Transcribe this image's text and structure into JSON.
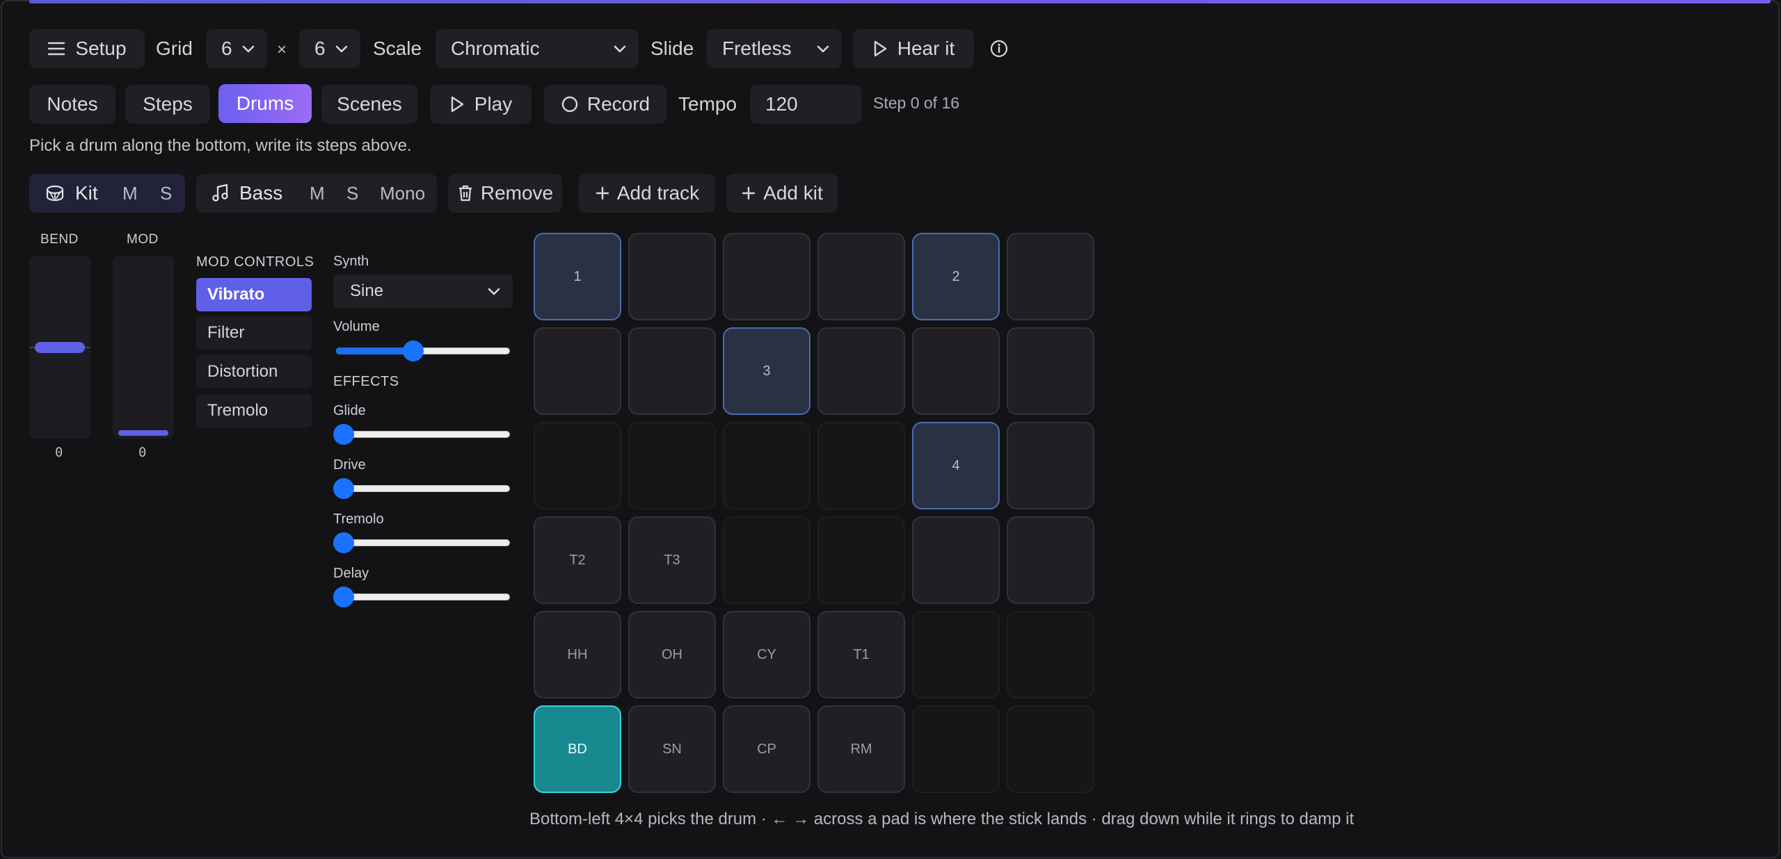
{
  "toolbar": {
    "setup_label": "Setup",
    "grid_label": "Grid",
    "grid_cols": "6",
    "times": "×",
    "grid_rows": "6",
    "scale_label": "Scale",
    "scale_value": "Chromatic",
    "slide_label": "Slide",
    "slide_value": "Fretless",
    "hear_label": "Hear it"
  },
  "tabs": {
    "notes": "Notes",
    "steps": "Steps",
    "drums": "Drums",
    "scenes": "Scenes",
    "active": "Drums"
  },
  "transport": {
    "play_label": "Play",
    "record_label": "Record",
    "tempo_label": "Tempo",
    "tempo_value": "120",
    "step_status": "Step 0 of 16"
  },
  "hint": "Pick a drum along the bottom, write its steps above.",
  "tracks": {
    "kit": {
      "name": "Kit",
      "mute": "M",
      "solo": "S"
    },
    "bass": {
      "name": "Bass",
      "mute": "M",
      "solo": "S",
      "mono": "Mono"
    },
    "remove_label": "Remove",
    "add_track_label": "Add track",
    "add_kit_label": "Add kit"
  },
  "bend": {
    "label": "BEND",
    "value": "0",
    "level": 0.5
  },
  "mod": {
    "label": "MOD",
    "value": "0",
    "level": 0
  },
  "mod_controls": {
    "title": "MOD CONTROLS",
    "items": [
      "Vibrato",
      "Filter",
      "Distortion",
      "Tremolo"
    ],
    "selected": "Vibrato"
  },
  "synth": {
    "label": "Synth",
    "value": "Sine",
    "volume_label": "Volume",
    "volume": 0.44,
    "effects_title": "EFFECTS",
    "glide_label": "Glide",
    "glide": 0,
    "drive_label": "Drive",
    "drive": 0,
    "tremolo_label": "Tremolo",
    "tremolo": 0,
    "delay_label": "Delay",
    "delay": 0
  },
  "pads": [
    [
      {
        "t": "step",
        "label": "1"
      },
      {
        "t": "normal",
        "label": ""
      },
      {
        "t": "normal",
        "label": ""
      },
      {
        "t": "normal",
        "label": ""
      },
      {
        "t": "step",
        "label": "2"
      },
      {
        "t": "normal",
        "label": ""
      }
    ],
    [
      {
        "t": "normal",
        "label": ""
      },
      {
        "t": "normal",
        "label": ""
      },
      {
        "t": "step",
        "label": "3"
      },
      {
        "t": "normal",
        "label": ""
      },
      {
        "t": "normal",
        "label": ""
      },
      {
        "t": "normal",
        "label": ""
      }
    ],
    [
      {
        "t": "empty",
        "label": ""
      },
      {
        "t": "empty",
        "label": ""
      },
      {
        "t": "empty",
        "label": ""
      },
      {
        "t": "empty",
        "label": ""
      },
      {
        "t": "step",
        "label": "4"
      },
      {
        "t": "normal",
        "label": ""
      }
    ],
    [
      {
        "t": "normal",
        "label": "T2"
      },
      {
        "t": "normal",
        "label": "T3"
      },
      {
        "t": "empty",
        "label": ""
      },
      {
        "t": "empty",
        "label": ""
      },
      {
        "t": "normal",
        "label": ""
      },
      {
        "t": "normal",
        "label": ""
      }
    ],
    [
      {
        "t": "normal",
        "label": "HH"
      },
      {
        "t": "normal",
        "label": "OH"
      },
      {
        "t": "normal",
        "label": "CY"
      },
      {
        "t": "normal",
        "label": "T1"
      },
      {
        "t": "empty",
        "label": ""
      },
      {
        "t": "empty",
        "label": ""
      }
    ],
    [
      {
        "t": "bd",
        "label": "BD"
      },
      {
        "t": "normal",
        "label": "SN"
      },
      {
        "t": "normal",
        "label": "CP"
      },
      {
        "t": "normal",
        "label": "RM"
      },
      {
        "t": "empty",
        "label": ""
      },
      {
        "t": "empty",
        "label": ""
      }
    ]
  ],
  "footer": "Bottom-left 4×4 picks the drum · ← → across a pad is where the stick lands · drag down while it rings to damp it",
  "colors": {
    "accent": "#6d5ff0",
    "selected_drum": "#17898f",
    "step_pad": "#2a3142",
    "slider": "#1a73ff"
  }
}
